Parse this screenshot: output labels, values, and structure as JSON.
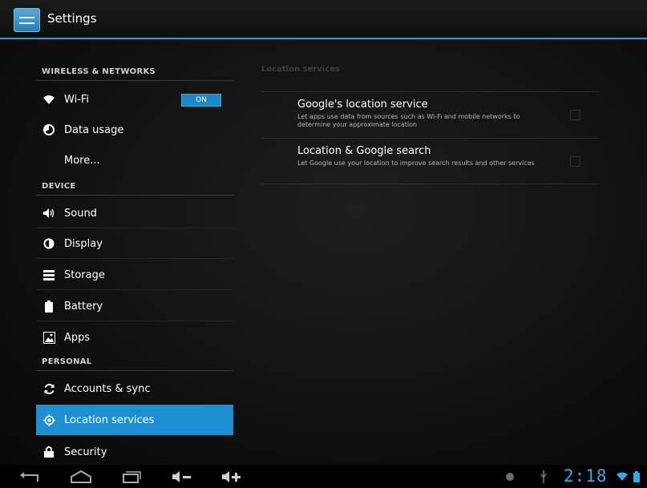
{
  "app": {
    "title": "Settings"
  },
  "sections": {
    "wireless": "WIRELESS & NETWORKS",
    "device": "DEVICE",
    "personal": "PERSONAL"
  },
  "items": {
    "wifi": {
      "label": "Wi-Fi",
      "toggle": "ON"
    },
    "data_usage": {
      "label": "Data usage"
    },
    "more": {
      "label": "More..."
    },
    "sound": {
      "label": "Sound"
    },
    "display": {
      "label": "Display"
    },
    "storage": {
      "label": "Storage"
    },
    "battery": {
      "label": "Battery"
    },
    "apps": {
      "label": "Apps"
    },
    "accounts": {
      "label": "Accounts & sync"
    },
    "location": {
      "label": "Location services"
    },
    "security": {
      "label": "Security"
    }
  },
  "detail": {
    "header": "Location services",
    "prefs": [
      {
        "title": "Google's location service",
        "summary": "Let apps use data from sources such as Wi-Fi and mobile networks to determine your approximate location",
        "checked": false
      },
      {
        "title": "Location & Google search",
        "summary": "Let Google use your location to improve search results and other services",
        "checked": false
      }
    ]
  },
  "status": {
    "time": "2:18"
  },
  "colors": {
    "accent": "#1e8fd0",
    "actionbar_underline": "#2a9ed6"
  }
}
